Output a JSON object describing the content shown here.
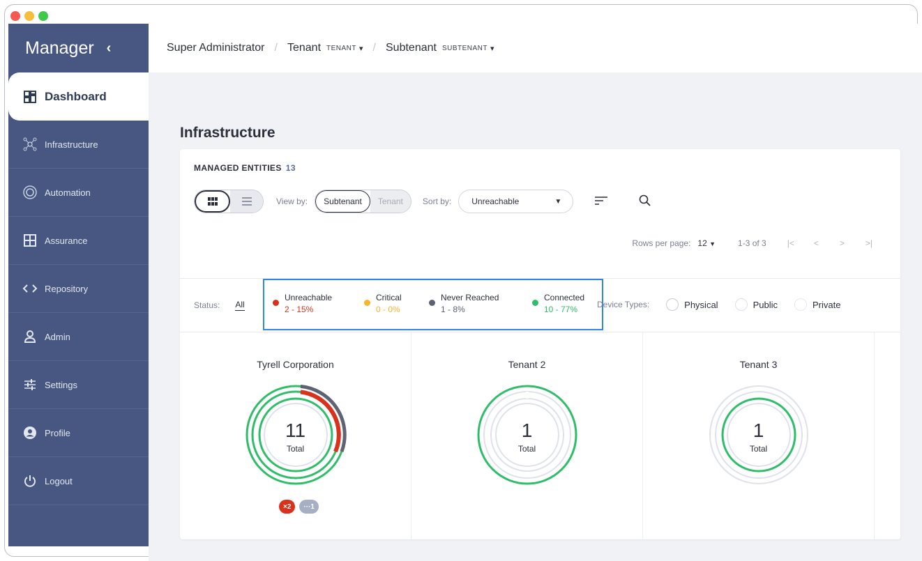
{
  "window": {
    "colors": {
      "close": "#f45952",
      "minimize": "#f6be3a",
      "zoom": "#3ec94a"
    }
  },
  "sidebar": {
    "brand": "Manager",
    "collapse_icon": "chevron-left-icon",
    "bg": "#475781",
    "items": [
      {
        "label": "Dashboard",
        "icon": "dashboard-icon",
        "active": true
      },
      {
        "label": "Infrastructure",
        "icon": "network-icon"
      },
      {
        "label": "Automation",
        "icon": "automation-icon"
      },
      {
        "label": "Assurance",
        "icon": "grid-icon"
      },
      {
        "label": "Repository",
        "icon": "code-icon"
      },
      {
        "label": "Admin",
        "icon": "user-icon"
      },
      {
        "label": "Settings",
        "icon": "sliders-icon"
      },
      {
        "label": "Profile",
        "icon": "profile-icon"
      },
      {
        "label": "Logout",
        "icon": "power-icon"
      }
    ]
  },
  "breadcrumb": {
    "root": "Super Administrator",
    "tenant_label": "Tenant",
    "tenant_tag": "TENANT",
    "subtenant_label": "Subtenant",
    "subtenant_tag": "SUBTENANT"
  },
  "page": {
    "title": "Infrastructure"
  },
  "managed": {
    "label": "MANAGED ENTITIES",
    "count": "13"
  },
  "toolbar": {
    "view_by_label": "View by:",
    "view_by_options": [
      "Subtenant",
      "Tenant"
    ],
    "view_by_selected": "Subtenant",
    "sort_by_label": "Sort by:",
    "sort_by_value": "Unreachable"
  },
  "pager": {
    "rows_label": "Rows per page:",
    "rows_value": "12",
    "range": "1-3 of 3"
  },
  "status": {
    "label": "Status:",
    "all": "All",
    "items": [
      {
        "name": "Unreachable",
        "value": "2 - 15%",
        "color": "#d8321d"
      },
      {
        "name": "Critical",
        "value": "0 - 0%",
        "color": "#f5b62e"
      },
      {
        "name": "Never Reached",
        "value": "1 - 8%",
        "color": "#5d6373"
      },
      {
        "name": "Connected",
        "value": "10 - 77%",
        "color": "#2fbd6a"
      }
    ]
  },
  "device_types": {
    "label": "Device Types:",
    "options": [
      "Physical",
      "Public",
      "Private"
    ]
  },
  "tiles": [
    {
      "name": "Tyrell Corporation",
      "total": "11",
      "total_label": "Total",
      "badges": [
        {
          "text": "×2",
          "color": "#d8321d"
        },
        {
          "text": "···1",
          "color": "#a6afc4"
        }
      ]
    },
    {
      "name": "Tenant 2",
      "total": "1",
      "total_label": "Total"
    },
    {
      "name": "Tenant 3",
      "total": "1",
      "total_label": "Total"
    }
  ]
}
